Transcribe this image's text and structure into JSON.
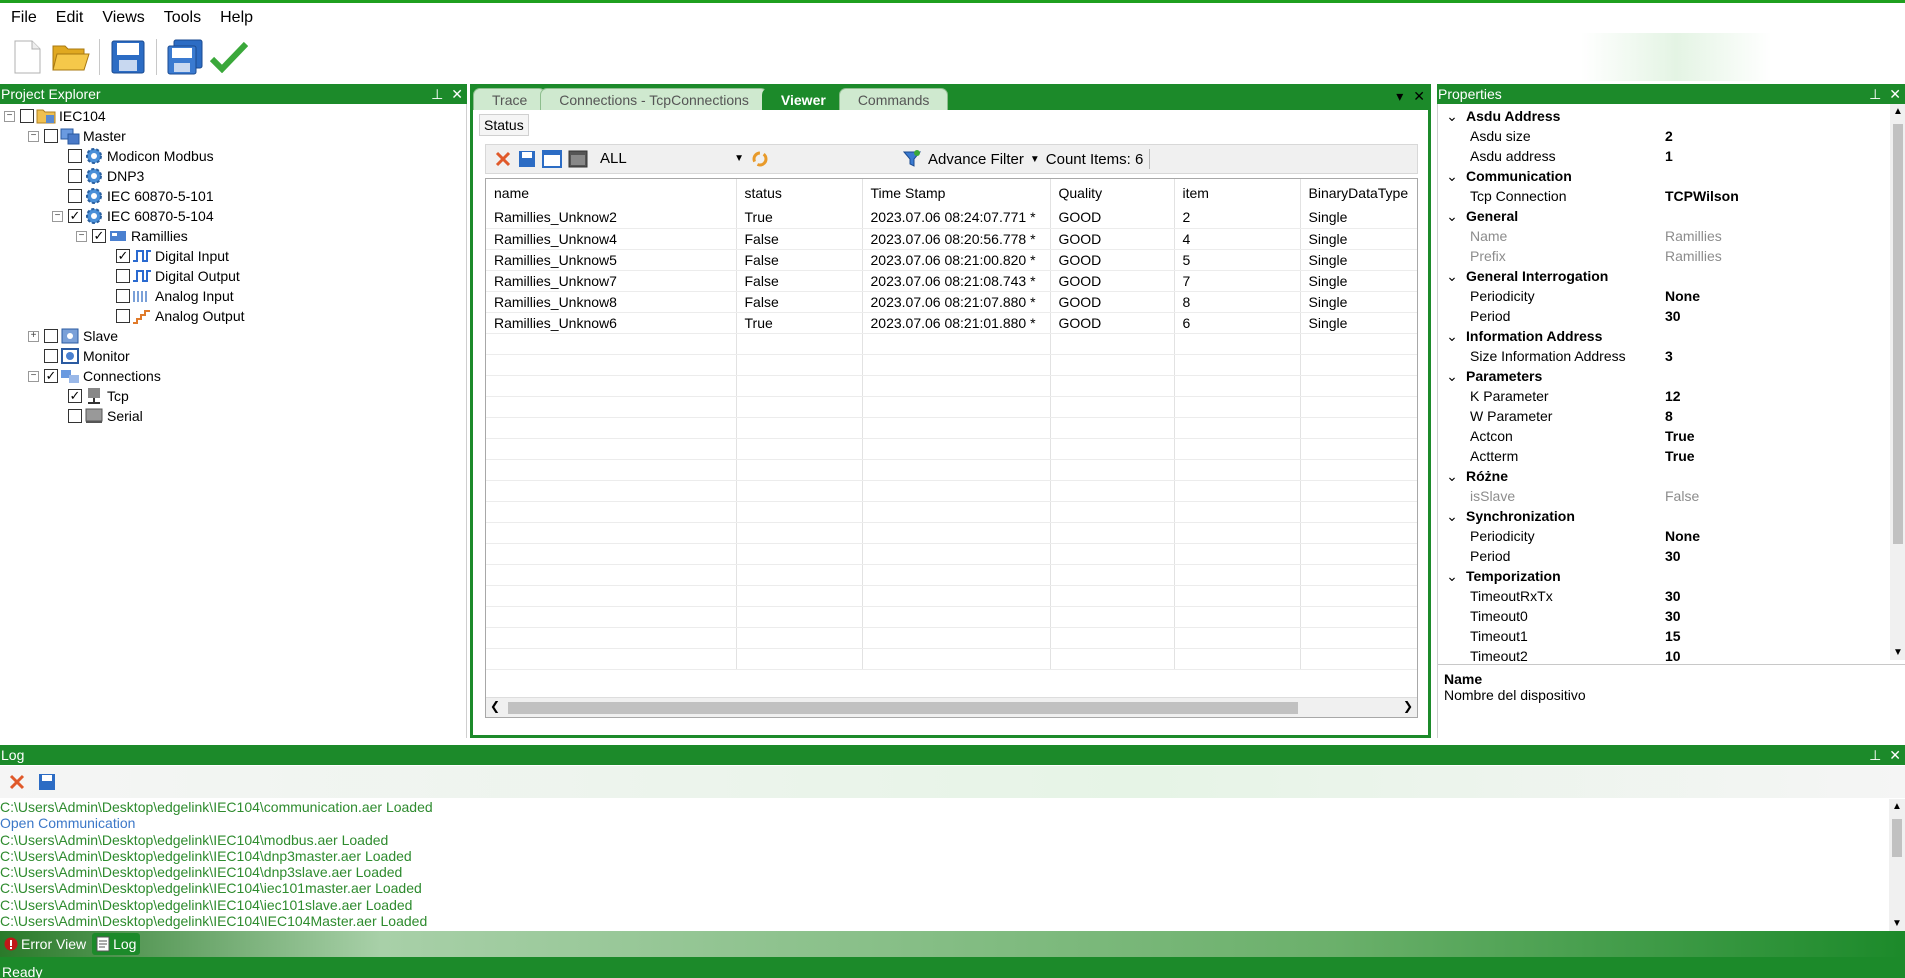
{
  "menu": [
    "File",
    "Edit",
    "Views",
    "Tools",
    "Help"
  ],
  "toolbar": {
    "icons": [
      "new-file-icon",
      "open-folder-icon",
      "save-icon",
      "save-all-icon",
      "check-icon"
    ]
  },
  "explorer": {
    "title": "Project Explorer",
    "pin": "⊥",
    "close": "✕",
    "tree": [
      {
        "label": "IEC104",
        "checked": false
      },
      {
        "label": "Master",
        "checked": false
      },
      {
        "label": "Modicon Modbus",
        "checked": false
      },
      {
        "label": "DNP3",
        "checked": false
      },
      {
        "label": "IEC 60870-5-101",
        "checked": false
      },
      {
        "label": "IEC 60870-5-104",
        "checked": true
      },
      {
        "label": "Ramillies",
        "checked": true
      },
      {
        "label": "Digital Input",
        "checked": true
      },
      {
        "label": "Digital Output",
        "checked": false
      },
      {
        "label": "Analog Input",
        "checked": false
      },
      {
        "label": "Analog Output",
        "checked": false
      },
      {
        "label": "Slave",
        "checked": false
      },
      {
        "label": "Monitor",
        "checked": false
      },
      {
        "label": "Connections",
        "checked": true
      },
      {
        "label": "Tcp",
        "checked": true
      },
      {
        "label": "Serial",
        "checked": false
      }
    ]
  },
  "viewer": {
    "tabs": [
      "Trace",
      "Connections - TcpConnections",
      "Viewer",
      "Commands"
    ],
    "active_tab": "Viewer",
    "sub_tab": "Status",
    "filter_value": "ALL",
    "advance_filter_label": "Advance Filter",
    "count_label": "Count Items: 6",
    "columns": [
      "name",
      "status",
      "Time Stamp",
      "Quality",
      "item",
      "BinaryDataType"
    ],
    "rows": [
      [
        "Ramillies_Unknow2",
        "True",
        "2023.07.06 08:24:07.771 *",
        "GOOD",
        "2",
        "Single"
      ],
      [
        "Ramillies_Unknow4",
        "False",
        "2023.07.06 08:20:56.778 *",
        "GOOD",
        "4",
        "Single"
      ],
      [
        "Ramillies_Unknow5",
        "False",
        "2023.07.06 08:21:00.820 *",
        "GOOD",
        "5",
        "Single"
      ],
      [
        "Ramillies_Unknow7",
        "False",
        "2023.07.06 08:21:08.743 *",
        "GOOD",
        "7",
        "Single"
      ],
      [
        "Ramillies_Unknow8",
        "False",
        "2023.07.06 08:21:07.880 *",
        "GOOD",
        "8",
        "Single"
      ],
      [
        "Ramillies_Unknow6",
        "True",
        "2023.07.06 08:21:01.880 *",
        "GOOD",
        "6",
        "Single"
      ]
    ]
  },
  "properties": {
    "title": "Properties",
    "rows": [
      {
        "type": "cat",
        "label": "Asdu Address"
      },
      {
        "type": "prop",
        "name": "Asdu size",
        "value": "2"
      },
      {
        "type": "prop",
        "name": "Asdu address",
        "value": "1"
      },
      {
        "type": "cat",
        "label": "Communication"
      },
      {
        "type": "prop",
        "name": "Tcp Connection",
        "value": "TCPWilson"
      },
      {
        "type": "cat",
        "label": "General"
      },
      {
        "type": "prop",
        "name": "Name",
        "value": "Ramillies",
        "disabled": true
      },
      {
        "type": "prop",
        "name": "Prefix",
        "value": "Ramillies",
        "disabled": true
      },
      {
        "type": "cat",
        "label": "General Interrogation"
      },
      {
        "type": "prop",
        "name": "Periodicity",
        "value": "None"
      },
      {
        "type": "prop",
        "name": "Period",
        "value": "30"
      },
      {
        "type": "cat",
        "label": "Information Address"
      },
      {
        "type": "prop",
        "name": "Size Information Address",
        "value": "3"
      },
      {
        "type": "cat",
        "label": "Parameters"
      },
      {
        "type": "prop",
        "name": "K Parameter",
        "value": "12"
      },
      {
        "type": "prop",
        "name": "W Parameter",
        "value": "8"
      },
      {
        "type": "prop",
        "name": "Actcon",
        "value": "True"
      },
      {
        "type": "prop",
        "name": "Actterm",
        "value": "True"
      },
      {
        "type": "cat",
        "label": "Różne"
      },
      {
        "type": "prop",
        "name": "isSlave",
        "value": "False",
        "disabled": true
      },
      {
        "type": "cat",
        "label": "Synchronization"
      },
      {
        "type": "prop",
        "name": "Periodicity",
        "value": "None"
      },
      {
        "type": "prop",
        "name": "Period",
        "value": "30"
      },
      {
        "type": "cat",
        "label": "Temporization"
      },
      {
        "type": "prop",
        "name": "TimeoutRxTx",
        "value": "30"
      },
      {
        "type": "prop",
        "name": "Timeout0",
        "value": "30"
      },
      {
        "type": "prop",
        "name": "Timeout1",
        "value": "15"
      },
      {
        "type": "prop",
        "name": "Timeout2",
        "value": "10"
      }
    ],
    "desc_title": "Name",
    "desc_text": "Nombre del dispositivo"
  },
  "log": {
    "title": "Log",
    "lines": [
      {
        "text": "C:\\Users\\Admin\\Desktop\\edgelink\\IEC104\\communication.aer Loaded",
        "kind": "ok"
      },
      {
        "text": "Open Communication",
        "kind": "info"
      },
      {
        "text": "C:\\Users\\Admin\\Desktop\\edgelink\\IEC104\\modbus.aer Loaded",
        "kind": "ok"
      },
      {
        "text": "C:\\Users\\Admin\\Desktop\\edgelink\\IEC104\\dnp3master.aer Loaded",
        "kind": "ok"
      },
      {
        "text": "C:\\Users\\Admin\\Desktop\\edgelink\\IEC104\\dnp3slave.aer Loaded",
        "kind": "ok"
      },
      {
        "text": "C:\\Users\\Admin\\Desktop\\edgelink\\IEC104\\iec101master.aer Loaded",
        "kind": "ok"
      },
      {
        "text": "C:\\Users\\Admin\\Desktop\\edgelink\\IEC104\\iec101slave.aer Loaded",
        "kind": "ok"
      },
      {
        "text": "C:\\Users\\Admin\\Desktop\\edgelink\\IEC104\\IEC104Master.aer Loaded",
        "kind": "ok"
      }
    ]
  },
  "bottom_tabs": [
    "Error View",
    "Log"
  ],
  "status_text": "Ready",
  "colors": {
    "accent": "#1c8a2a",
    "log_ok": "#2e8b2e",
    "log_info": "#3c78c8"
  }
}
